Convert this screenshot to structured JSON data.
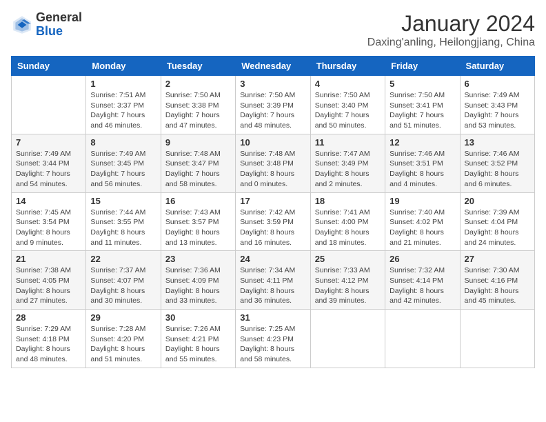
{
  "header": {
    "logo_general": "General",
    "logo_blue": "Blue",
    "month_title": "January 2024",
    "location": "Daxing'anling, Heilongjiang, China"
  },
  "columns": [
    "Sunday",
    "Monday",
    "Tuesday",
    "Wednesday",
    "Thursday",
    "Friday",
    "Saturday"
  ],
  "weeks": [
    [
      {
        "day": "",
        "info": ""
      },
      {
        "day": "1",
        "info": "Sunrise: 7:51 AM\nSunset: 3:37 PM\nDaylight: 7 hours\nand 46 minutes."
      },
      {
        "day": "2",
        "info": "Sunrise: 7:50 AM\nSunset: 3:38 PM\nDaylight: 7 hours\nand 47 minutes."
      },
      {
        "day": "3",
        "info": "Sunrise: 7:50 AM\nSunset: 3:39 PM\nDaylight: 7 hours\nand 48 minutes."
      },
      {
        "day": "4",
        "info": "Sunrise: 7:50 AM\nSunset: 3:40 PM\nDaylight: 7 hours\nand 50 minutes."
      },
      {
        "day": "5",
        "info": "Sunrise: 7:50 AM\nSunset: 3:41 PM\nDaylight: 7 hours\nand 51 minutes."
      },
      {
        "day": "6",
        "info": "Sunrise: 7:49 AM\nSunset: 3:43 PM\nDaylight: 7 hours\nand 53 minutes."
      }
    ],
    [
      {
        "day": "7",
        "info": "Sunrise: 7:49 AM\nSunset: 3:44 PM\nDaylight: 7 hours\nand 54 minutes."
      },
      {
        "day": "8",
        "info": "Sunrise: 7:49 AM\nSunset: 3:45 PM\nDaylight: 7 hours\nand 56 minutes."
      },
      {
        "day": "9",
        "info": "Sunrise: 7:48 AM\nSunset: 3:47 PM\nDaylight: 7 hours\nand 58 minutes."
      },
      {
        "day": "10",
        "info": "Sunrise: 7:48 AM\nSunset: 3:48 PM\nDaylight: 8 hours\nand 0 minutes."
      },
      {
        "day": "11",
        "info": "Sunrise: 7:47 AM\nSunset: 3:49 PM\nDaylight: 8 hours\nand 2 minutes."
      },
      {
        "day": "12",
        "info": "Sunrise: 7:46 AM\nSunset: 3:51 PM\nDaylight: 8 hours\nand 4 minutes."
      },
      {
        "day": "13",
        "info": "Sunrise: 7:46 AM\nSunset: 3:52 PM\nDaylight: 8 hours\nand 6 minutes."
      }
    ],
    [
      {
        "day": "14",
        "info": "Sunrise: 7:45 AM\nSunset: 3:54 PM\nDaylight: 8 hours\nand 9 minutes."
      },
      {
        "day": "15",
        "info": "Sunrise: 7:44 AM\nSunset: 3:55 PM\nDaylight: 8 hours\nand 11 minutes."
      },
      {
        "day": "16",
        "info": "Sunrise: 7:43 AM\nSunset: 3:57 PM\nDaylight: 8 hours\nand 13 minutes."
      },
      {
        "day": "17",
        "info": "Sunrise: 7:42 AM\nSunset: 3:59 PM\nDaylight: 8 hours\nand 16 minutes."
      },
      {
        "day": "18",
        "info": "Sunrise: 7:41 AM\nSunset: 4:00 PM\nDaylight: 8 hours\nand 18 minutes."
      },
      {
        "day": "19",
        "info": "Sunrise: 7:40 AM\nSunset: 4:02 PM\nDaylight: 8 hours\nand 21 minutes."
      },
      {
        "day": "20",
        "info": "Sunrise: 7:39 AM\nSunset: 4:04 PM\nDaylight: 8 hours\nand 24 minutes."
      }
    ],
    [
      {
        "day": "21",
        "info": "Sunrise: 7:38 AM\nSunset: 4:05 PM\nDaylight: 8 hours\nand 27 minutes."
      },
      {
        "day": "22",
        "info": "Sunrise: 7:37 AM\nSunset: 4:07 PM\nDaylight: 8 hours\nand 30 minutes."
      },
      {
        "day": "23",
        "info": "Sunrise: 7:36 AM\nSunset: 4:09 PM\nDaylight: 8 hours\nand 33 minutes."
      },
      {
        "day": "24",
        "info": "Sunrise: 7:34 AM\nSunset: 4:11 PM\nDaylight: 8 hours\nand 36 minutes."
      },
      {
        "day": "25",
        "info": "Sunrise: 7:33 AM\nSunset: 4:12 PM\nDaylight: 8 hours\nand 39 minutes."
      },
      {
        "day": "26",
        "info": "Sunrise: 7:32 AM\nSunset: 4:14 PM\nDaylight: 8 hours\nand 42 minutes."
      },
      {
        "day": "27",
        "info": "Sunrise: 7:30 AM\nSunset: 4:16 PM\nDaylight: 8 hours\nand 45 minutes."
      }
    ],
    [
      {
        "day": "28",
        "info": "Sunrise: 7:29 AM\nSunset: 4:18 PM\nDaylight: 8 hours\nand 48 minutes."
      },
      {
        "day": "29",
        "info": "Sunrise: 7:28 AM\nSunset: 4:20 PM\nDaylight: 8 hours\nand 51 minutes."
      },
      {
        "day": "30",
        "info": "Sunrise: 7:26 AM\nSunset: 4:21 PM\nDaylight: 8 hours\nand 55 minutes."
      },
      {
        "day": "31",
        "info": "Sunrise: 7:25 AM\nSunset: 4:23 PM\nDaylight: 8 hours\nand 58 minutes."
      },
      {
        "day": "",
        "info": ""
      },
      {
        "day": "",
        "info": ""
      },
      {
        "day": "",
        "info": ""
      }
    ]
  ]
}
